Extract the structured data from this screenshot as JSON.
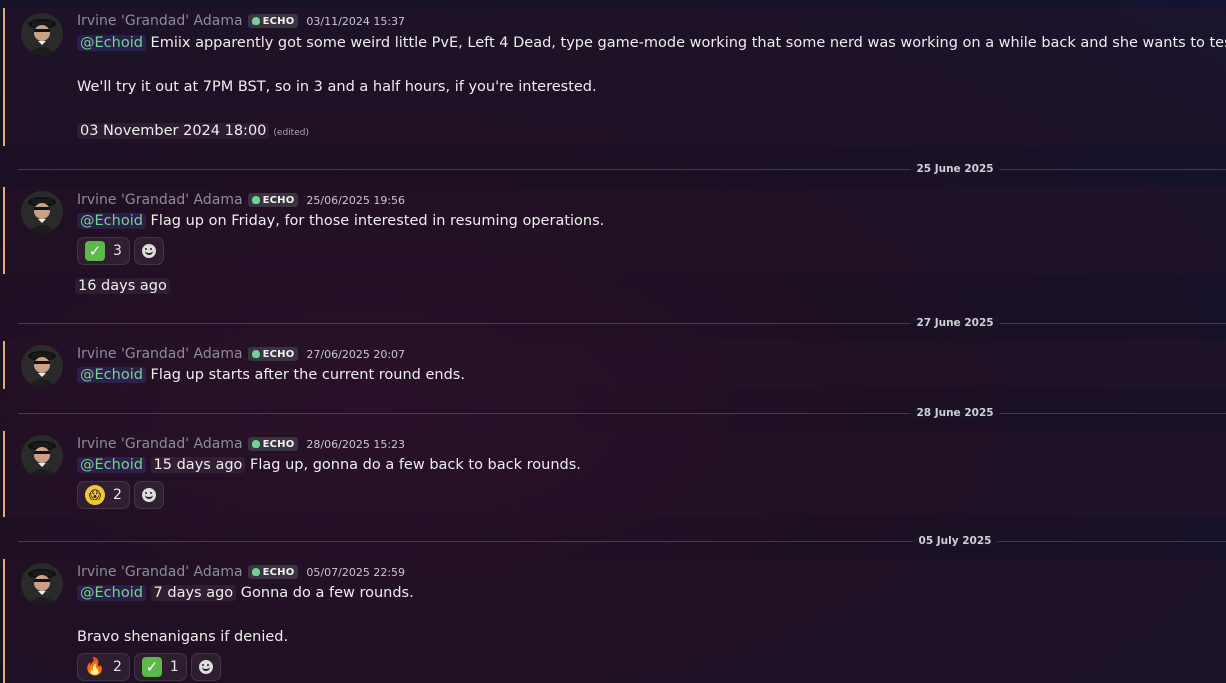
{
  "messages": [
    {
      "author": "Irvine 'Grandad' Adama",
      "tag": "ECHO",
      "timestamp": "03/11/2024 15:37",
      "mention": "@Echoid",
      "text1": "Emiix apparently got some weird little PvE, Left 4 Dead, type game-mode working that some nerd was working on a while back and she wants to test it out.",
      "text2": "We'll try it out at 7PM BST, so in 3 and a half hours, if you're interested.",
      "date_chip": "03 November 2024 18:00",
      "edited": "(edited)"
    },
    {
      "author": "Irvine 'Grandad' Adama",
      "tag": "ECHO",
      "timestamp": "25/06/2025 19:56",
      "mention": "@Echoid",
      "text1": "Flag up on Friday, for those interested in resuming operations.",
      "reactions": [
        {
          "emoji": "check-mark",
          "count": "3"
        }
      ],
      "relative_chip": "16 days ago"
    },
    {
      "author": "Irvine 'Grandad' Adama",
      "tag": "ECHO",
      "timestamp": "27/06/2025 20:07",
      "mention": "@Echoid",
      "text1": "Flag up starts after the current round ends."
    },
    {
      "author": "Irvine 'Grandad' Adama",
      "tag": "ECHO",
      "timestamp": "28/06/2025 15:23",
      "mention": "@Echoid",
      "relative_chip": "15 days ago",
      "text1": "Flag up, gonna do a few back to back rounds.",
      "reactions": [
        {
          "emoji": "screaming-face",
          "count": "2"
        }
      ]
    },
    {
      "author": "Irvine 'Grandad' Adama",
      "tag": "ECHO",
      "timestamp": "05/07/2025 22:59",
      "mention": "@Echoid",
      "relative_chip": "7 days ago",
      "text1": "Gonna do a few rounds.",
      "text2": "Bravo shenanigans if denied.",
      "reactions": [
        {
          "emoji": "fire",
          "count": "2"
        },
        {
          "emoji": "check-mark",
          "count": "1"
        }
      ]
    }
  ],
  "dividers": [
    "25 June 2025",
    "27 June 2025",
    "28 June 2025",
    "05 July 2025"
  ],
  "colors": {
    "mention": "#74d38c",
    "accent_bar": "#d8b070",
    "tag_icon": "#6fd39a"
  }
}
